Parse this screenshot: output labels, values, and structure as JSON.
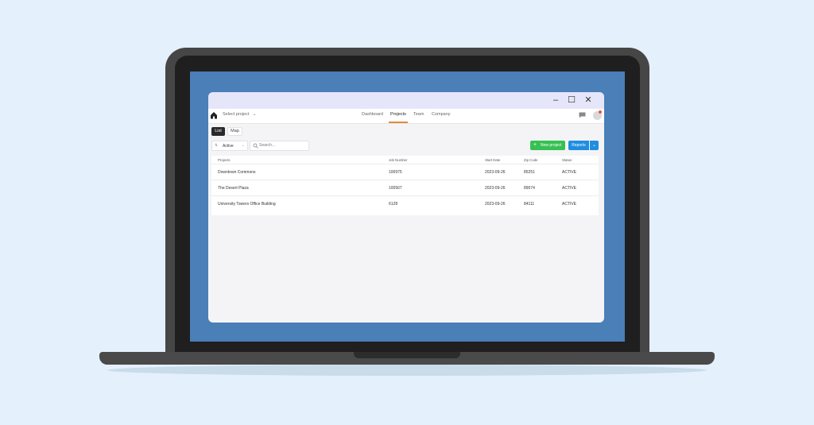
{
  "nav": {
    "select_project": "Select project",
    "tabs": [
      "Dashboard",
      "Projects",
      "Team",
      "Company"
    ],
    "active_tab": "Projects"
  },
  "view": {
    "list_label": "List",
    "map_label": "Map"
  },
  "toolbar": {
    "filter_value": "Active",
    "search_placeholder": "Search...",
    "new_project_label": "New project",
    "reports_label": "Reports"
  },
  "table": {
    "columns": [
      "Projects",
      "Job Number",
      "Start Date",
      "Zip Code",
      "Status"
    ],
    "rows": [
      [
        "Downtown Commons",
        "100975",
        "2023-09-26",
        "85251",
        "ACTIVE"
      ],
      [
        "The Desert Plaza",
        "100567",
        "2023-09-26",
        "89074",
        "ACTIVE"
      ],
      [
        "University Towers Office Building",
        "6128",
        "2023-09-26",
        "84111",
        "ACTIVE"
      ]
    ]
  },
  "colors": {
    "accent_green": "#37c053",
    "accent_blue": "#1f8ee0",
    "active_tab_underline": "#e58a3a"
  },
  "icons": [
    "home-icon",
    "chevron-down-icon",
    "chat-icon",
    "filter-icon",
    "search-icon",
    "plus-icon",
    "minimize-icon",
    "maximize-icon",
    "close-icon"
  ]
}
